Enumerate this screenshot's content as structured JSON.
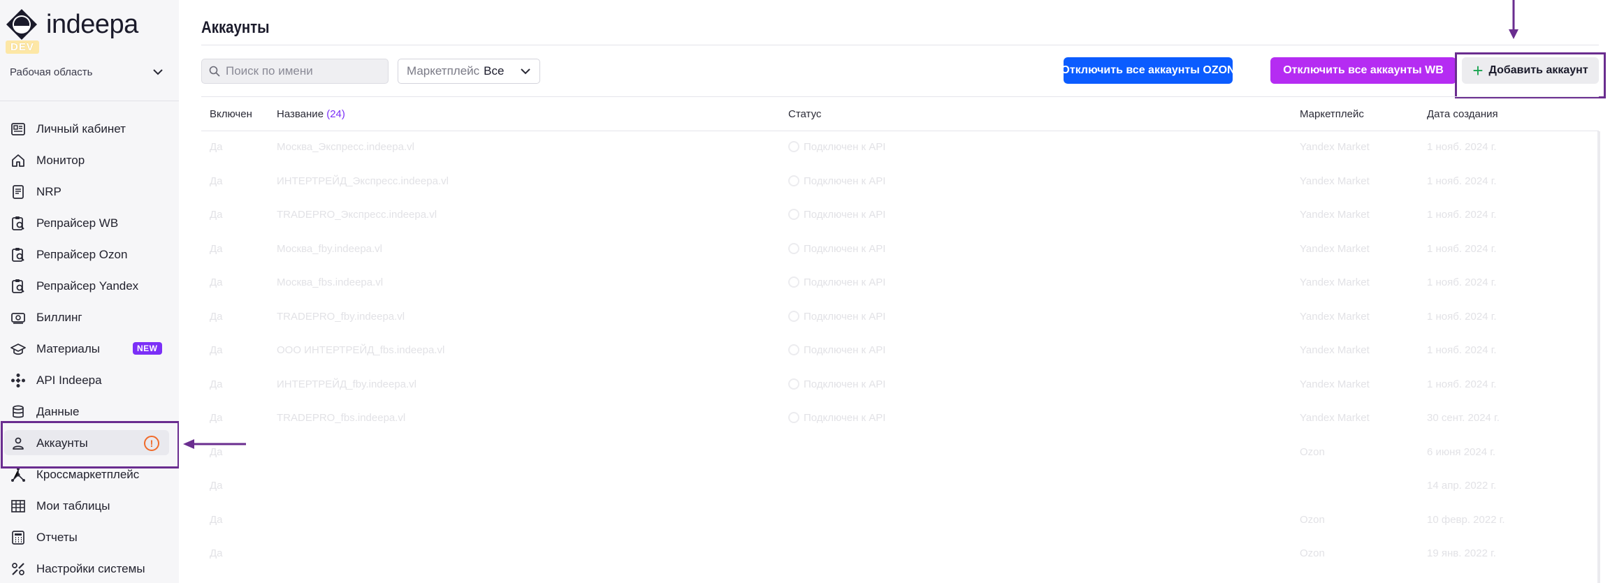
{
  "app": {
    "logo_text": "indeepa",
    "env_badge": "DEV",
    "workspace": "Рабочая область"
  },
  "sidebar": {
    "items": [
      {
        "label": "Личный кабинет",
        "icon": "dashboard-icon"
      },
      {
        "label": "Монитор",
        "icon": "home-icon"
      },
      {
        "label": "NRP",
        "icon": "document-icon"
      },
      {
        "label": "Репрайсер WB",
        "icon": "clipboard-search-icon"
      },
      {
        "label": "Репрайсер Ozon",
        "icon": "clipboard-search-icon"
      },
      {
        "label": "Репрайсер Yandex",
        "icon": "clipboard-search-icon"
      },
      {
        "label": "Биллинг",
        "icon": "money-icon"
      },
      {
        "label": "Материалы",
        "icon": "graduation-cap-icon",
        "badge": "NEW"
      },
      {
        "label": "API Indeepa",
        "icon": "api-icon"
      },
      {
        "label": "Данные",
        "icon": "database-icon"
      },
      {
        "label": "Аккаунты",
        "icon": "user-icon",
        "active": true,
        "alert": "!"
      },
      {
        "label": "Кроссмаркетплейс",
        "icon": "share-nodes-icon"
      },
      {
        "label": "Мои таблицы",
        "icon": "table-icon"
      },
      {
        "label": "Отчеты",
        "icon": "calculator-icon"
      },
      {
        "label": "Настройки системы",
        "icon": "tools-icon"
      }
    ]
  },
  "header": {
    "title": "Аккаунты"
  },
  "toolbar": {
    "search_placeholder": "Поиск по имени",
    "marketplace_label": "Маркетплейс",
    "marketplace_value": "Все",
    "disable_ozon": "Отключить все аккаунты OZON",
    "disable_wb": "Отключить все аккаунты WB",
    "add_account": "Добавить аккаунт"
  },
  "table": {
    "columns": {
      "enabled": "Включен",
      "name": "Название",
      "count": "(24)",
      "status": "Статус",
      "marketplace": "Маркетплейс",
      "created": "Дата создания"
    },
    "rows": [
      {
        "enabled": "Да",
        "name": "Москва_Экспресс.indeepa.vl",
        "status": "Подключен к API",
        "marketplace": "Yandex Market",
        "created": "1 нояб. 2024 г."
      },
      {
        "enabled": "Да",
        "name": "ИНТЕРТРЕЙД_Экспресс.indeepa.vl",
        "status": "Подключен к API",
        "marketplace": "Yandex Market",
        "created": "1 нояб. 2024 г."
      },
      {
        "enabled": "Да",
        "name": "TRADEPRO_Экспресс.indeepa.vl",
        "status": "Подключен к API",
        "marketplace": "Yandex Market",
        "created": "1 нояб. 2024 г."
      },
      {
        "enabled": "Да",
        "name": "Москва_fby.indeepa.vl",
        "status": "Подключен к API",
        "marketplace": "Yandex Market",
        "created": "1 нояб. 2024 г."
      },
      {
        "enabled": "Да",
        "name": "Москва_fbs.indeepa.vl",
        "status": "Подключен к API",
        "marketplace": "Yandex Market",
        "created": "1 нояб. 2024 г."
      },
      {
        "enabled": "Да",
        "name": "TRADEPRO_fby.indeepa.vl",
        "status": "Подключен к API",
        "marketplace": "Yandex Market",
        "created": "1 нояб. 2024 г."
      },
      {
        "enabled": "Да",
        "name": "ООО ИНТЕРТРЕЙД_fbs.indeepa.vl",
        "status": "Подключен к API",
        "marketplace": "Yandex Market",
        "created": "1 нояб. 2024 г."
      },
      {
        "enabled": "Да",
        "name": "ИНТЕРТРЕЙД_fby.indeepa.vl",
        "status": "Подключен к API",
        "marketplace": "Yandex Market",
        "created": "1 нояб. 2024 г."
      },
      {
        "enabled": "Да",
        "name": "TRADEPRO_fbs.indeepa.vl",
        "status": "Подключен к API",
        "marketplace": "Yandex Market",
        "created": "30 сент. 2024 г."
      },
      {
        "enabled": "Да",
        "name": "",
        "status": "",
        "marketplace": "Ozon",
        "created": "6 июня 2024 г."
      },
      {
        "enabled": "Да",
        "name": "",
        "status": "",
        "marketplace": "",
        "created": "14 апр. 2022 г."
      },
      {
        "enabled": "Да",
        "name": "",
        "status": "",
        "marketplace": "Ozon",
        "created": "10 февр. 2022 г."
      },
      {
        "enabled": "Да",
        "name": "",
        "status": "",
        "marketplace": "Ozon",
        "created": "19 янв. 2022 г."
      }
    ]
  },
  "colors": {
    "primary_blue": "#0b5cff",
    "wb_purple": "#b52cf2",
    "annotation": "#6a2d8f",
    "new_badge": "#7b2ff7",
    "warning": "#f06a2a"
  }
}
